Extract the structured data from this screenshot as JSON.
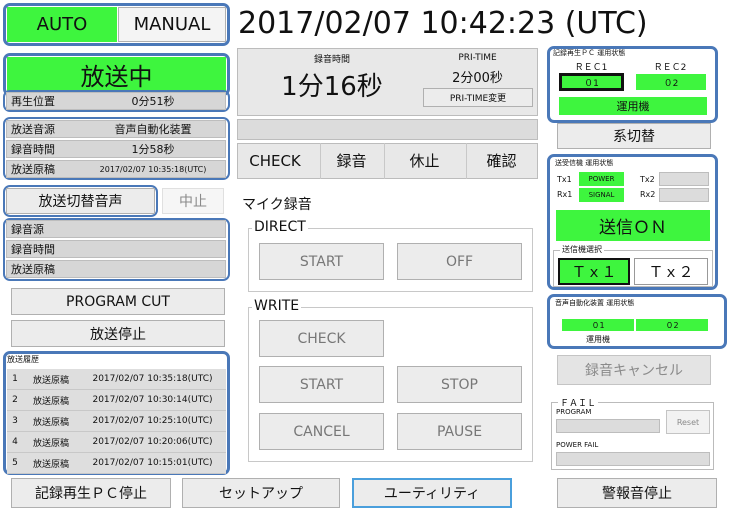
{
  "mode": {
    "auto": "AUTO",
    "manual": "MANUAL"
  },
  "clock": "2017/02/07 10:42:23 (UTC)",
  "status": {
    "on_air": "放送中"
  },
  "playback": {
    "label": "再生位置",
    "value": "0分51秒"
  },
  "source": {
    "label": "放送音源",
    "value": "音声自動化装置"
  },
  "rec_time": {
    "label": "録音時間",
    "value": "1分58秒"
  },
  "script": {
    "label": "放送原稿",
    "value": "2017/02/07 10:35:18(UTC)"
  },
  "switch_voice": {
    "button": "放送切替音声",
    "stop": "中止"
  },
  "empty_rows": [
    "録音源",
    "録音時間",
    "放送原稿"
  ],
  "program_cut": "PROGRAM CUT",
  "broadcast_stop": "放送停止",
  "history": {
    "title": "放送履歴",
    "rows": [
      {
        "n": "1",
        "type": "放送原稿",
        "time": "2017/02/07 10:35:18(UTC)"
      },
      {
        "n": "2",
        "type": "放送原稿",
        "time": "2017/02/07 10:30:14(UTC)"
      },
      {
        "n": "3",
        "type": "放送原稿",
        "time": "2017/02/07 10:25:10(UTC)"
      },
      {
        "n": "4",
        "type": "放送原稿",
        "time": "2017/02/07 10:20:06(UTC)"
      },
      {
        "n": "5",
        "type": "放送原稿",
        "time": "2017/02/07 10:15:01(UTC)"
      }
    ]
  },
  "rec_display": {
    "label": "録音時間",
    "value": "1分16秒"
  },
  "pri_time": {
    "label": "PRI-TIME",
    "value": "2分00秒",
    "change": "PRI-TIME変更"
  },
  "check_row": {
    "check": "CHECK",
    "rec": "録音",
    "pause": "休止",
    "confirm": "確認"
  },
  "mic": {
    "title": "マイク録音",
    "direct": {
      "title": "DIRECT",
      "start": "START",
      "off": "OFF"
    },
    "write": {
      "title": "WRITE",
      "check": "CHECK",
      "start": "START",
      "stop": "STOP",
      "cancel": "CANCEL",
      "pause": "PAUSE"
    }
  },
  "rec_pc": {
    "title": "記録再生ＰＣ 運用状態",
    "rec1": "ＲＥＣ1",
    "rec2": "ＲＥＣ2",
    "v1": "０1",
    "v2": "０2",
    "operating": "運用機",
    "switch": "系切替"
  },
  "tx": {
    "title": "送受信機 運用状態",
    "tx1": "Tx1",
    "power": "POWER",
    "tx2": "Tx2",
    "rx1": "Rx1",
    "signal": "SIGNAL",
    "rx2": "Rx2",
    "send_on": "送信ＯＮ",
    "select_title": "送信機選択",
    "sel1": "Ｔｘ１",
    "sel2": "Ｔｘ２"
  },
  "audio_auto": {
    "title": "音声自動化装置 運用状態",
    "v1": "０1",
    "v2": "０2",
    "operating": "運用機"
  },
  "rec_cancel": "録音キャンセル",
  "fail": {
    "title": "ＦＡＩＬ",
    "program": "PROGRAM",
    "reset": "Reset",
    "power_fail": "POWER FAIL"
  },
  "bottom": {
    "pc_stop": "記録再生ＰＣ停止",
    "setup": "セットアップ",
    "utility": "ユーティリティ",
    "alarm_stop": "警報音停止"
  },
  "colors": {
    "accent_green": "#3ef53e",
    "highlight_blue": "#4a78b8"
  }
}
